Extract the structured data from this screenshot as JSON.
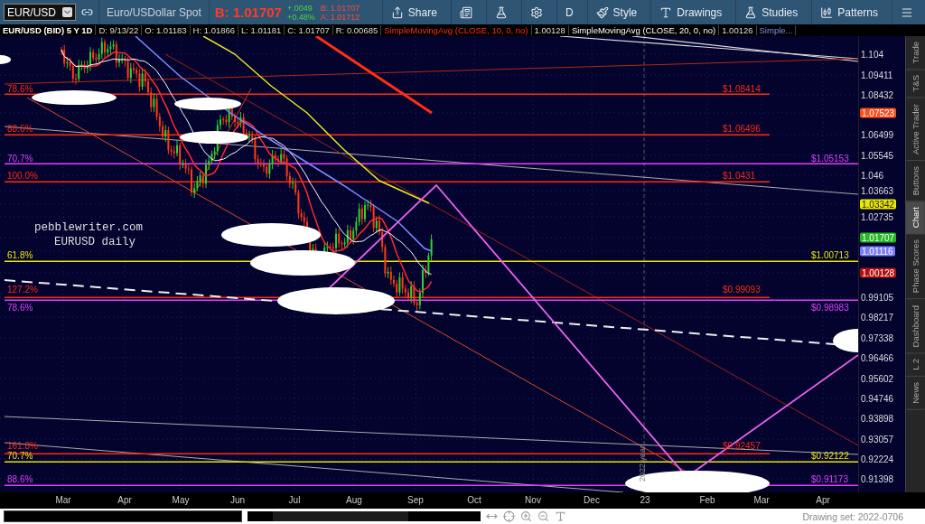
{
  "toolbar": {
    "symbol": "EUR/USD",
    "description": "Euro/USDollar Spot",
    "last": "B: 1.01707",
    "change": "+.0049",
    "change_pct": "+0.48%",
    "bid": "B: 1.01707",
    "ask": "A: 1.01712",
    "buttons": [
      {
        "kind": "share",
        "label": "Share"
      },
      {
        "kind": "news"
      },
      {
        "kind": "flask"
      },
      {
        "kind": "gear"
      },
      {
        "kind": "text",
        "label": "D"
      },
      {
        "kind": "style",
        "label": "Style"
      },
      {
        "kind": "drawings",
        "label": "Drawings"
      },
      {
        "kind": "studies",
        "label": "Studies"
      },
      {
        "kind": "patterns",
        "label": "Patterns"
      },
      {
        "kind": "menu"
      }
    ]
  },
  "info_bar": {
    "title": "EUR/USD (BID) 5 Y 1D",
    "fields": [
      "D: 9/13/22",
      "O: 1.01183",
      "H: 1.01866",
      "L: 1.01181",
      "C: 1.01707",
      "R: 0.00685"
    ],
    "studies": [
      {
        "name": "SimpleMovingAvg (CLOSE, 10, 0, no)",
        "value": "1.00128",
        "color": "#ff2a2a"
      },
      {
        "name": "SimpleMovingAvg (CLOSE, 20, 0, no)",
        "value": "1.00126",
        "color": "#ffffff"
      },
      {
        "name": "Simple...",
        "color": "#7f8cff"
      }
    ]
  },
  "chart": {
    "notes": [
      "pebblewriter.com",
      "EURUSD daily"
    ],
    "year_label": "2022 year",
    "fib_tools": [
      {
        "color": "#ff2a10",
        "levels": [
          {
            "percent": "78.6%",
            "price": "$1.08414"
          },
          {
            "percent": "88.6%",
            "price": "$1.06496"
          },
          {
            "percent": "100.0%",
            "price": "$1.0431"
          },
          {
            "percent": "127.2%",
            "price": "$0.99093"
          },
          {
            "percent": "161.8%",
            "price": "$0.92457"
          }
        ]
      },
      {
        "color": "#e040ff",
        "levels": [
          {
            "percent": "70.7%",
            "price": "$1.05153"
          },
          {
            "percent": "78.6%",
            "price": "$0.98983"
          },
          {
            "percent": "88.6%",
            "price": "$0.91173"
          }
        ]
      },
      {
        "color": "#e8e800",
        "levels": [
          {
            "percent": "61.8%",
            "price": "$1.00713"
          },
          {
            "percent": "70.7%",
            "price": "$0.92122"
          }
        ]
      }
    ]
  },
  "price_axis": [
    {
      "kind": "tick",
      "text": "1.104"
    },
    {
      "kind": "tick",
      "text": "1.09411"
    },
    {
      "kind": "tick",
      "text": "1.08432"
    },
    {
      "kind": "tag",
      "text": "1.07523",
      "color": "#ff4a1a"
    },
    {
      "kind": "tick",
      "text": "1.06499"
    },
    {
      "kind": "tick",
      "text": "1.05545"
    },
    {
      "kind": "tick",
      "text": "1.046"
    },
    {
      "kind": "tick",
      "text": "1.03663"
    },
    {
      "kind": "tag",
      "text": "1.03342",
      "color": "#e8e800"
    },
    {
      "kind": "tick",
      "text": "1.02735"
    },
    {
      "kind": "tag",
      "text": "1.01707",
      "color": "#22b822"
    },
    {
      "kind": "tag",
      "text": "1.01116",
      "color": "#7a7aff"
    },
    {
      "kind": "tag",
      "text": "1.00128",
      "color": "#b01010"
    },
    {
      "kind": "tick",
      "text": "0.99105"
    },
    {
      "kind": "tick",
      "text": "0.98217"
    },
    {
      "kind": "tick",
      "text": "0.97338"
    },
    {
      "kind": "tick",
      "text": "0.96466"
    },
    {
      "kind": "tick",
      "text": "0.95602"
    },
    {
      "kind": "tick",
      "text": "0.94746"
    },
    {
      "kind": "tick",
      "text": "0.93898"
    },
    {
      "kind": "tick",
      "text": "0.93057"
    },
    {
      "kind": "tick",
      "text": "0.92224"
    },
    {
      "kind": "tick",
      "text": "0.91398"
    }
  ],
  "months": [
    "Mar",
    "Apr",
    "May",
    "Jun",
    "Jul",
    "Aug",
    "Sep",
    "Oct",
    "Nov",
    "Dec",
    "23",
    "Feb",
    "Mar",
    "Apr"
  ],
  "side_tabs": [
    {
      "label": "Trade",
      "selected": false
    },
    {
      "label": "T&S",
      "selected": false
    },
    {
      "label": "Active Trader",
      "selected": false
    },
    {
      "label": "Buttons",
      "selected": false
    },
    {
      "label": "Chart",
      "selected": true
    },
    {
      "label": "Phase Scores",
      "selected": false
    },
    {
      "label": "Dashboard",
      "selected": false
    },
    {
      "label": "L 2",
      "selected": false
    },
    {
      "label": "News",
      "selected": false
    }
  ],
  "status_bar": {
    "drawing_set": "Drawing set: 2022-0706"
  }
}
